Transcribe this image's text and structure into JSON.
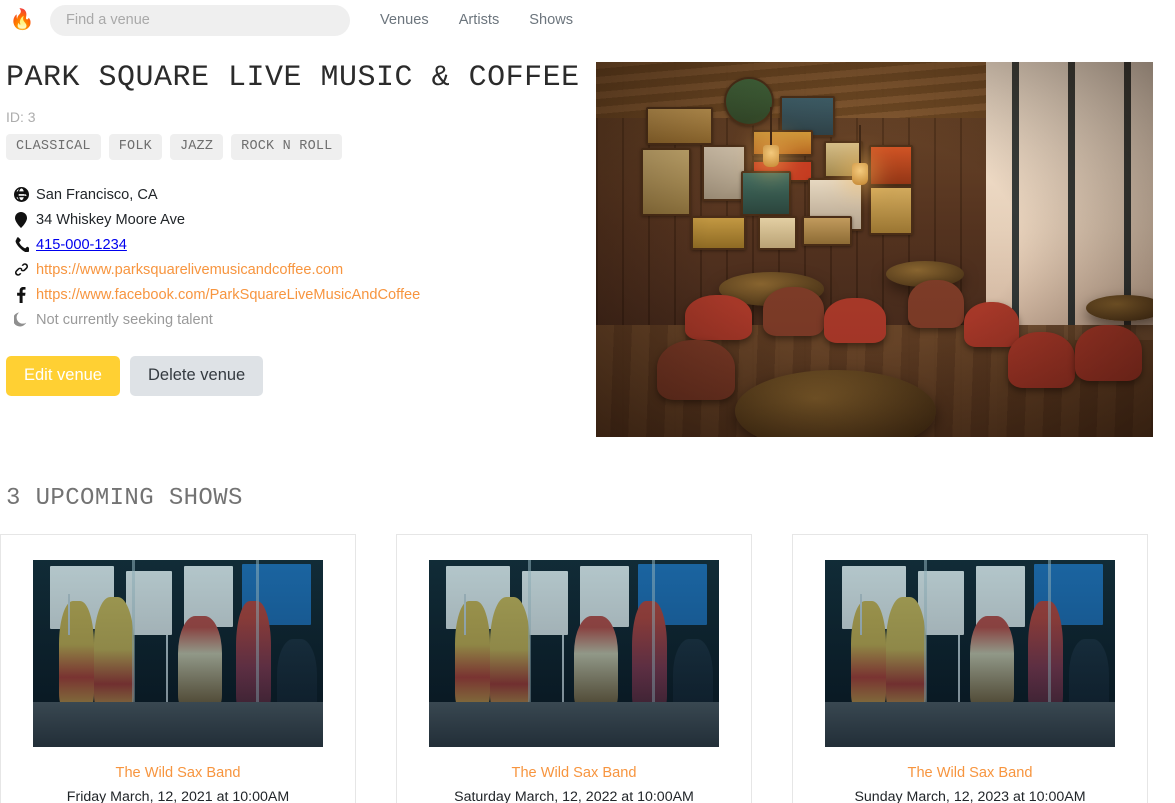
{
  "header": {
    "logo_icon": "flame-icon",
    "search": {
      "placeholder": "Find a venue",
      "value": ""
    },
    "nav": [
      {
        "label": "Venues"
      },
      {
        "label": "Artists"
      },
      {
        "label": "Shows"
      }
    ]
  },
  "venue": {
    "name": "PARK SQUARE LIVE MUSIC & COFFEE",
    "id_label": "ID: 3",
    "genres": [
      "CLASSICAL",
      "FOLK",
      "JAZZ",
      "ROCK N ROLL"
    ],
    "contact": {
      "city_state": "San Francisco, CA",
      "address": "34 Whiskey Moore Ave",
      "phone": "415-000-1234",
      "website": "https://www.parksquarelivemusicandcoffee.com",
      "facebook": "https://www.facebook.com/ParkSquareLiveMusicAndCoffee",
      "seeking": "Not currently seeking talent"
    },
    "actions": {
      "edit_label": "Edit venue",
      "delete_label": "Delete venue"
    },
    "photo_alt": "Pub interior with vintage wall signs and wooden tables"
  },
  "shows": {
    "heading": "3 UPCOMING SHOWS",
    "items": [
      {
        "artist": "The Wild Sax Band",
        "date": "Friday March, 12, 2021 at 10:00AM"
      },
      {
        "artist": "The Wild Sax Band",
        "date": "Saturday March, 12, 2022 at 10:00AM"
      },
      {
        "artist": "The Wild Sax Band",
        "date": "Sunday March, 12, 2023 at 10:00AM"
      }
    ]
  },
  "colors": {
    "accent_orange": "#f7953f",
    "edit_yellow": "#ffd033",
    "delete_gray": "#dee2e6",
    "link_blue": "#0000ee",
    "muted_gray": "#9a9a9a"
  }
}
